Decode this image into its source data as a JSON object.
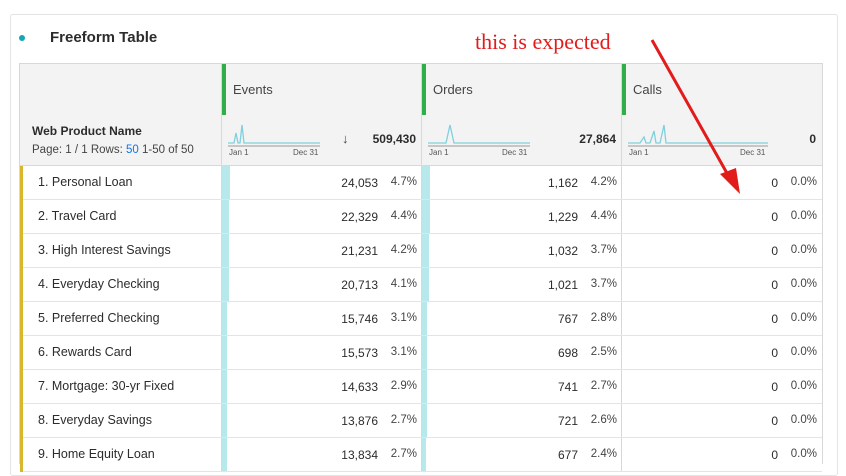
{
  "panel": {
    "title": "Freeform Table"
  },
  "annotation": {
    "text": "this is expected",
    "color": "#e21b1b"
  },
  "columns": [
    {
      "name": "Events",
      "total": "509,430",
      "sorted": true,
      "sort_icon": "arrow-down-icon"
    },
    {
      "name": "Orders",
      "total": "27,864",
      "sorted": false
    },
    {
      "name": "Calls",
      "total": "0",
      "sorted": false
    }
  ],
  "dimension": {
    "name": "Web Product Name",
    "page_prefix": "Page: 1 / 1 Rows:",
    "rows_per_page": "50",
    "range": "1-50 of 50"
  },
  "sparkline": {
    "start_label": "Jan 1",
    "end_label": "Dec 31"
  },
  "rows": [
    {
      "label": "1. Personal Loan",
      "events": "24,053",
      "events_pct": "4.7%",
      "events_fill": 1.0,
      "orders": "1,162",
      "orders_pct": "4.2%",
      "orders_fill": 0.95,
      "calls": "0",
      "calls_pct": "0.0%"
    },
    {
      "label": "2. Travel Card",
      "events": "22,329",
      "events_pct": "4.4%",
      "events_fill": 0.93,
      "orders": "1,229",
      "orders_pct": "4.4%",
      "orders_fill": 1.0,
      "calls": "0",
      "calls_pct": "0.0%"
    },
    {
      "label": "3. High Interest Savings",
      "events": "21,231",
      "events_pct": "4.2%",
      "events_fill": 0.88,
      "orders": "1,032",
      "orders_pct": "3.7%",
      "orders_fill": 0.84,
      "calls": "0",
      "calls_pct": "0.0%"
    },
    {
      "label": "4. Everyday Checking",
      "events": "20,713",
      "events_pct": "4.1%",
      "events_fill": 0.86,
      "orders": "1,021",
      "orders_pct": "3.7%",
      "orders_fill": 0.83,
      "calls": "0",
      "calls_pct": "0.0%"
    },
    {
      "label": "5. Preferred Checking",
      "events": "15,746",
      "events_pct": "3.1%",
      "events_fill": 0.65,
      "orders": "767",
      "orders_pct": "2.8%",
      "orders_fill": 0.62,
      "calls": "0",
      "calls_pct": "0.0%"
    },
    {
      "label": "6. Rewards Card",
      "events": "15,573",
      "events_pct": "3.1%",
      "events_fill": 0.65,
      "orders": "698",
      "orders_pct": "2.5%",
      "orders_fill": 0.57,
      "calls": "0",
      "calls_pct": "0.0%"
    },
    {
      "label": "7. Mortgage: 30-yr Fixed",
      "events": "14,633",
      "events_pct": "2.9%",
      "events_fill": 0.61,
      "orders": "741",
      "orders_pct": "2.7%",
      "orders_fill": 0.6,
      "calls": "0",
      "calls_pct": "0.0%"
    },
    {
      "label": "8. Everyday Savings",
      "events": "13,876",
      "events_pct": "2.7%",
      "events_fill": 0.58,
      "orders": "721",
      "orders_pct": "2.6%",
      "orders_fill": 0.59,
      "calls": "0",
      "calls_pct": "0.0%"
    },
    {
      "label": "9. Home Equity Loan",
      "events": "13,834",
      "events_pct": "2.7%",
      "events_fill": 0.58,
      "orders": "677",
      "orders_pct": "2.4%",
      "orders_fill": 0.55,
      "calls": "0",
      "calls_pct": "0.0%"
    }
  ],
  "colors": {
    "metric_header": "#2fae4a",
    "row_marker": "#d8b72c",
    "cell_fill": "#b7e8ec",
    "sparkline": "#7fd0dc",
    "link": "#1473e6"
  }
}
